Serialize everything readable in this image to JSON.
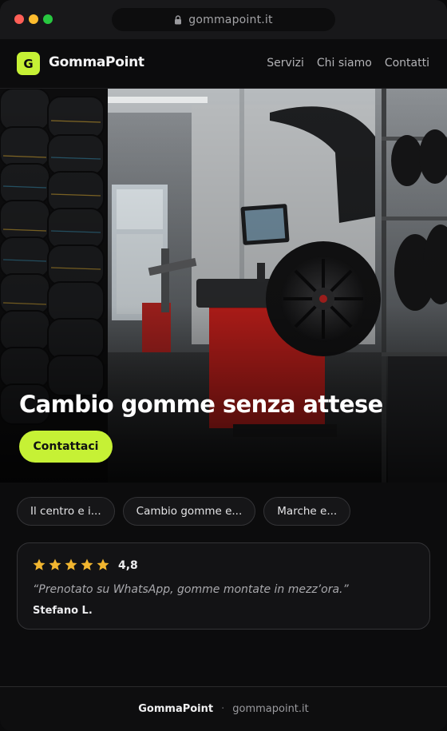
{
  "browser": {
    "url": "gommapoint.it",
    "icons": {
      "lock": "lock-icon"
    }
  },
  "header": {
    "logo_letter": "G",
    "brand": "GommaPoint",
    "nav": [
      {
        "label": "Servizi"
      },
      {
        "label": "Chi siamo"
      },
      {
        "label": "Contatti"
      }
    ]
  },
  "hero": {
    "title": "Cambio gomme senza attese",
    "cta_label": "Contattaci",
    "image_description_icon": "tire-shop-photo"
  },
  "chips": [
    {
      "label": "Il centro e i..."
    },
    {
      "label": "Cambio gomme e..."
    },
    {
      "label": "Marche e..."
    }
  ],
  "review": {
    "stars": 5,
    "rating": "4,8",
    "quote": "“Prenotato su WhatsApp, gomme montate in mezz’ora.”",
    "author": "Stefano L."
  },
  "footer": {
    "brand": "GommaPoint",
    "separator": "·",
    "domain": "gommapoint.it"
  },
  "colors": {
    "accent": "#c6f135",
    "background": "#0c0c0d",
    "star": "#f2b630",
    "machine_red": "#c8201c"
  }
}
